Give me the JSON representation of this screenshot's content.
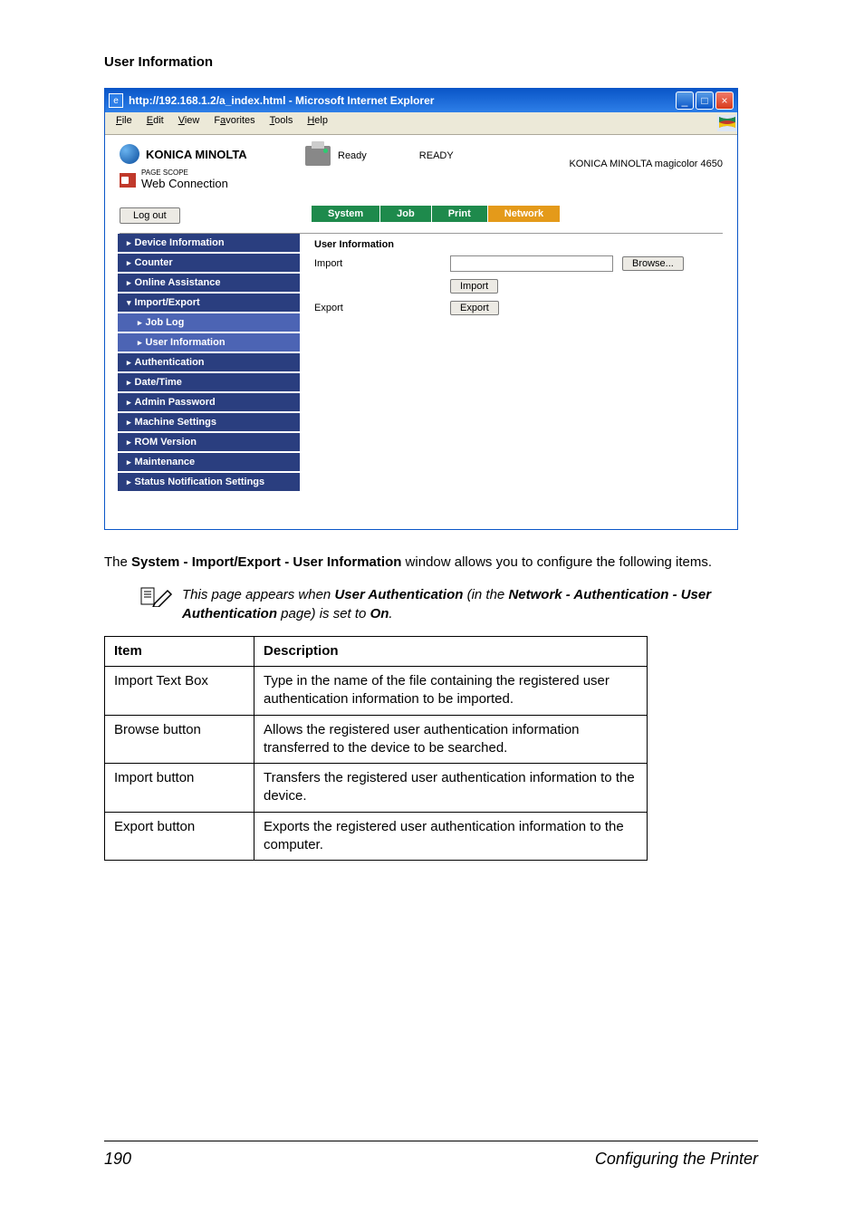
{
  "page": {
    "section_heading": "User Information",
    "body_text_1": "The ",
    "body_text_2": " window allows you to configure the following items.",
    "bold_path": "System - Import/Export - User Information",
    "note_prefix": "This page appears when ",
    "note_bold1": "User Authentication",
    "note_mid1": " (in the ",
    "note_bold2": "Network - Authentication - User Authentication",
    "note_mid2": " page) is set to ",
    "note_bold3": "On",
    "note_end": ".",
    "footer_page": "190",
    "footer_label": "Configuring the Printer"
  },
  "browser": {
    "titlebar": "http://192.168.1.2/a_index.html - Microsoft Internet Explorer",
    "menu": {
      "file": "File",
      "edit": "Edit",
      "view": "View",
      "favorites": "Favorites",
      "tools": "Tools",
      "help": "Help"
    },
    "brand": "KONICA MINOLTA",
    "pagescope_small": "PAGE SCOPE",
    "pagescope": "Web Connection",
    "status_ready": "Ready",
    "status_ready_label": "READY",
    "model": "KONICA MINOLTA magicolor 4650",
    "logout": "Log out",
    "tabs": {
      "system": "System",
      "job": "Job",
      "print": "Print",
      "network": "Network"
    },
    "sidebar": {
      "device_info": "Device Information",
      "counter": "Counter",
      "online": "Online Assistance",
      "import_export": "Import/Export",
      "job_log": "Job Log",
      "user_info": "User Information",
      "authentication": "Authentication",
      "datetime": "Date/Time",
      "admin_pw": "Admin Password",
      "machine": "Machine Settings",
      "rom": "ROM Version",
      "maintenance": "Maintenance",
      "status_notif": "Status Notification Settings"
    },
    "panel": {
      "title": "User Information",
      "import_label": "Import",
      "export_label": "Export",
      "browse_btn": "Browse...",
      "import_btn": "Import",
      "export_btn": "Export"
    }
  },
  "table": {
    "h1": "Item",
    "h2": "Description",
    "rows": [
      {
        "item": "Import Text Box",
        "desc": "Type in the name of the file containing the registered user authentication information to be imported."
      },
      {
        "item": "Browse button",
        "desc": "Allows the registered user authentication information transferred to the device to be searched."
      },
      {
        "item": "Import button",
        "desc": "Transfers the registered user authentication information to the device."
      },
      {
        "item": "Export button",
        "desc": "Exports the registered user authentication information to the computer."
      }
    ]
  }
}
